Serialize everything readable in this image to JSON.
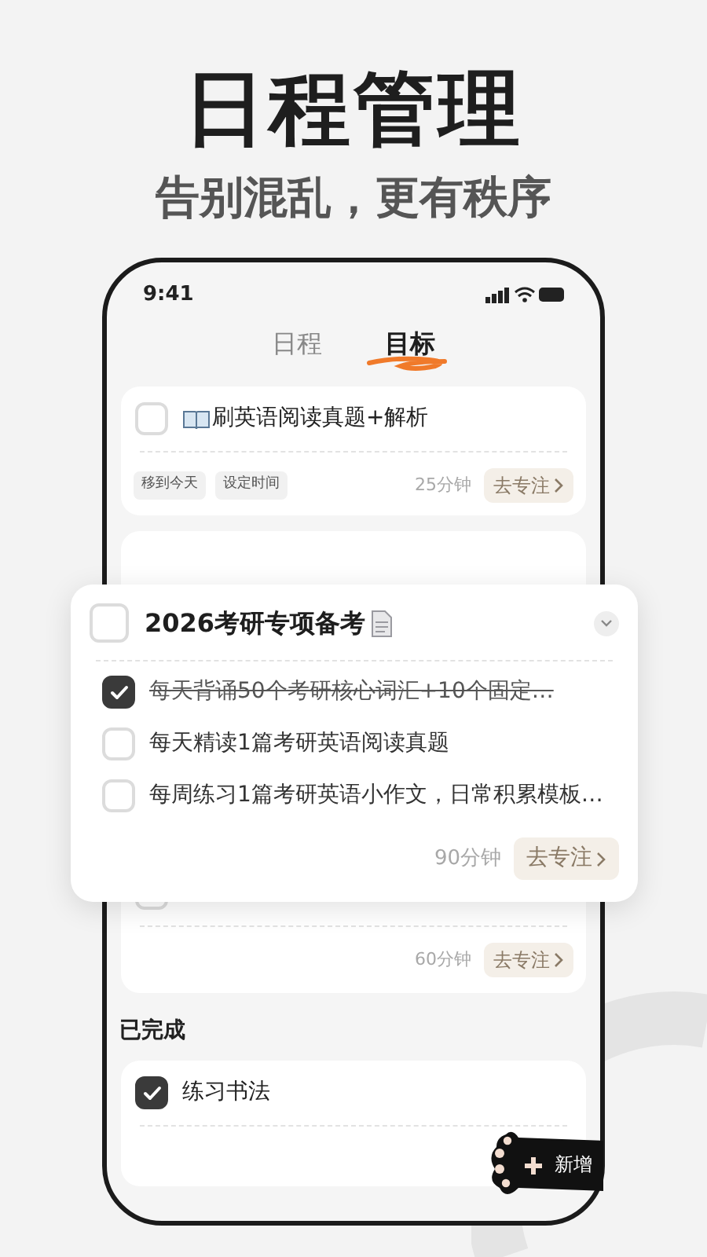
{
  "headline": "日程管理",
  "subtitle": "告别混乱，更有秩序",
  "status_bar": {
    "time": "9:41"
  },
  "tabs": [
    {
      "label": "日程",
      "selected": false
    },
    {
      "label": "目标",
      "selected": true
    }
  ],
  "goals": [
    {
      "checked": false,
      "title": "刷英语阅读真题+解析",
      "tags": [
        "移到今天",
        "设定时间"
      ],
      "duration": "25分钟",
      "action": "去专注"
    },
    {
      "checked": false,
      "duration": "60分钟",
      "action": "去专注"
    }
  ],
  "expanded_goal": {
    "checked": false,
    "title": "2026考研专项备考",
    "expanded": true,
    "subtasks": [
      {
        "checked": true,
        "text": "每天背诵50个考研核心词汇+10个固定…"
      },
      {
        "checked": false,
        "text": "每天精读1篇考研英语阅读真题"
      },
      {
        "checked": false,
        "text": "每周练习1篇考研英语小作文，日常积累模板…"
      }
    ],
    "duration": "90分钟",
    "action": "去专注"
  },
  "completed": {
    "heading": "已完成",
    "items": [
      {
        "checked": true,
        "title": "练习书法"
      }
    ]
  },
  "add_button": {
    "label": "新增"
  }
}
